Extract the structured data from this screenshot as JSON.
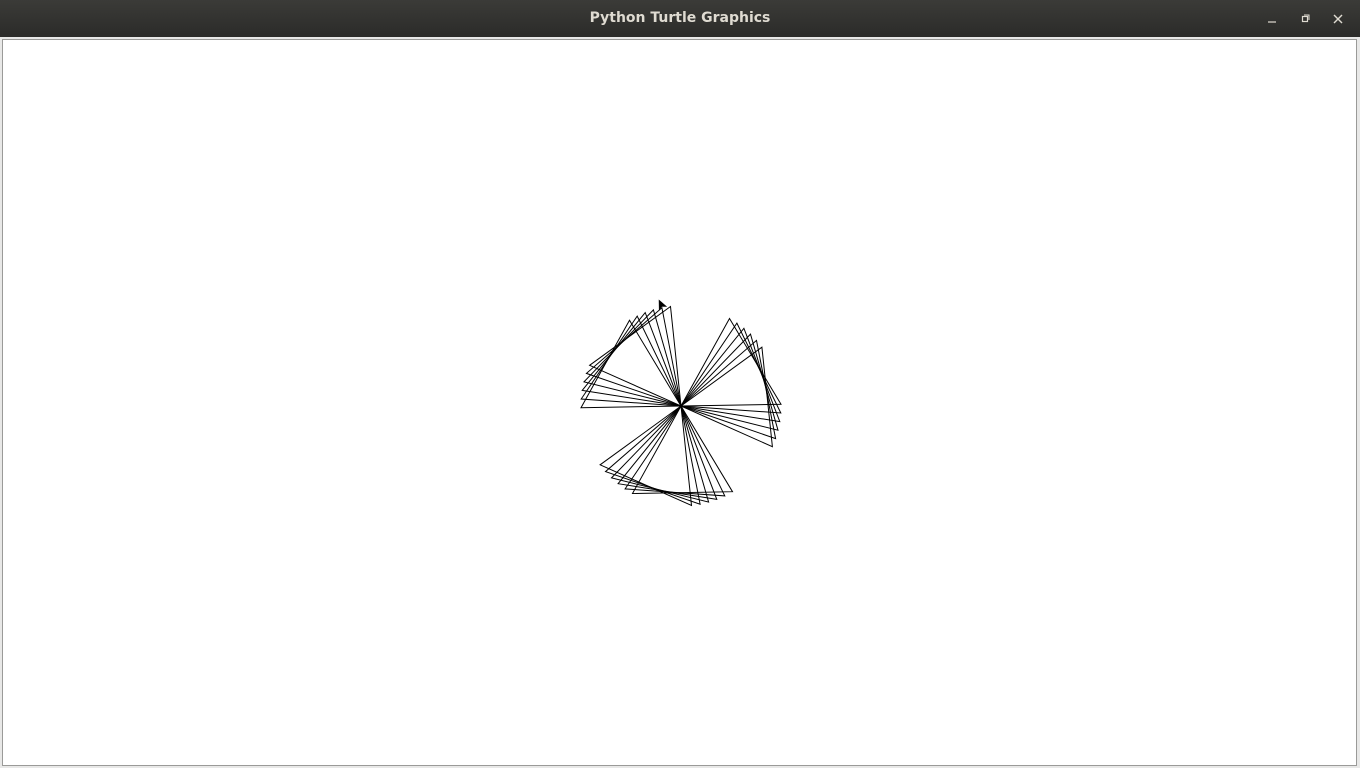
{
  "window": {
    "title": "Python Turtle Graphics",
    "controls": [
      "minimize-icon",
      "maximize-icon",
      "close-icon"
    ]
  },
  "canvas": {
    "background": "#ffffff",
    "pen_color": "#000000",
    "turtle_cursor": "arrow-icon"
  }
}
